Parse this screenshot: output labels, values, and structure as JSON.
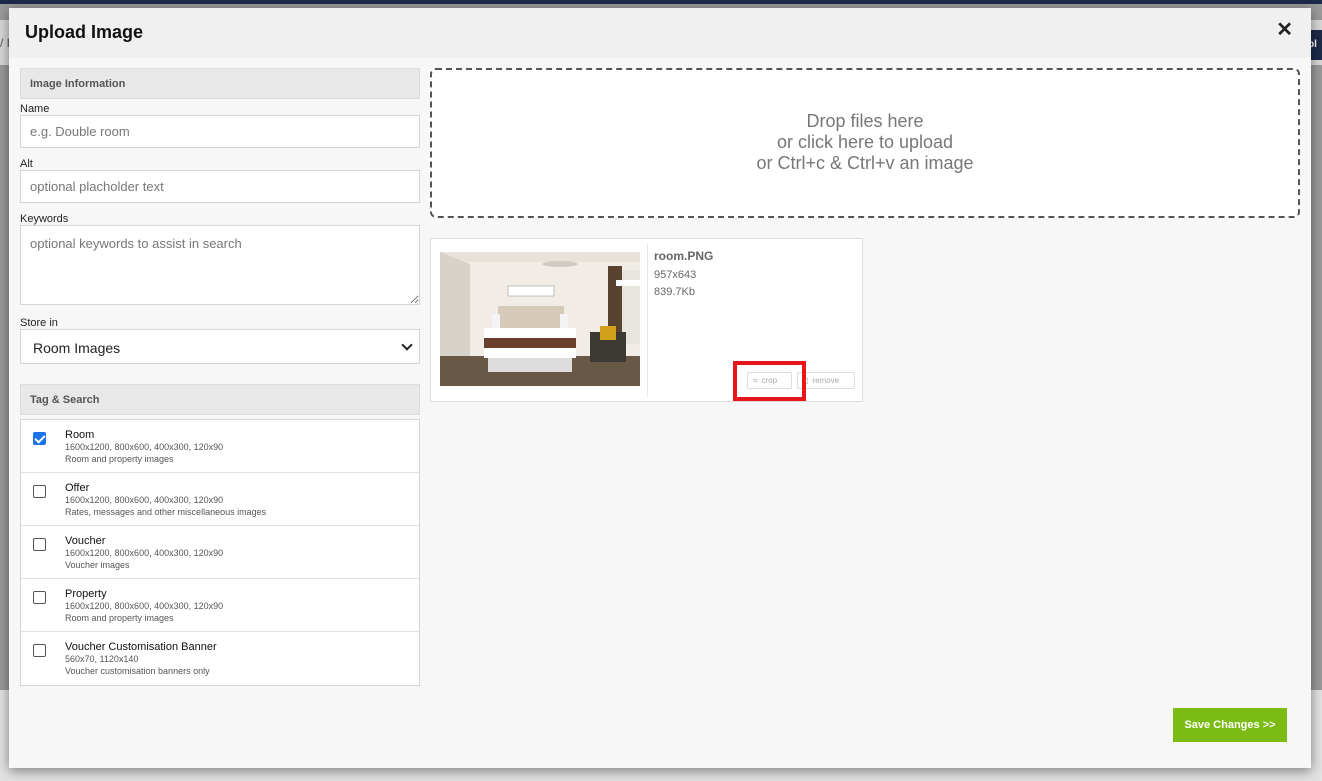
{
  "background": {
    "right_tab_text": "pl",
    "left_mark": "/ I"
  },
  "modal": {
    "title": "Upload Image"
  },
  "image_info": {
    "section_title": "Image Information",
    "name_label": "Name",
    "name_placeholder": "e.g. Double room",
    "alt_label": "Alt",
    "alt_placeholder": "optional placholder text",
    "keywords_label": "Keywords",
    "keywords_placeholder": "optional keywords to assist in search",
    "store_label": "Store in",
    "store_value": "Room Images"
  },
  "tag_search": {
    "section_title": "Tag & Search",
    "items": [
      {
        "name": "Room",
        "sizes": "1600x1200, 800x600, 400x300, 120x90",
        "desc": "Room and property images",
        "checked": true
      },
      {
        "name": "Offer",
        "sizes": "1600x1200, 800x600, 400x300, 120x90",
        "desc": "Rates, messages and other miscellaneous images",
        "checked": false
      },
      {
        "name": "Voucher",
        "sizes": "1600x1200, 800x600, 400x300, 120x90",
        "desc": "Voucher images",
        "checked": false
      },
      {
        "name": "Property",
        "sizes": "1600x1200, 800x600, 400x300, 120x90",
        "desc": "Room and property images",
        "checked": false
      },
      {
        "name": "Voucher Customisation Banner",
        "sizes": "560x70, 1120x140",
        "desc": "Voucher customisation banners only",
        "checked": false
      }
    ]
  },
  "dropzone": {
    "line1": "Drop files here",
    "line2": "or click here to upload",
    "line3": "or Ctrl+c & Ctrl+v an image"
  },
  "file": {
    "name": "room.PNG",
    "dimensions": "957x643",
    "size": "839.7Kb",
    "crop_label": "crop",
    "remove_label": "remove"
  },
  "footer": {
    "save_label": "Save Changes >>"
  },
  "colors": {
    "accent_green": "#7cbb14",
    "highlight_red": "#e8151b",
    "checkbox_blue": "#1a73e8"
  }
}
